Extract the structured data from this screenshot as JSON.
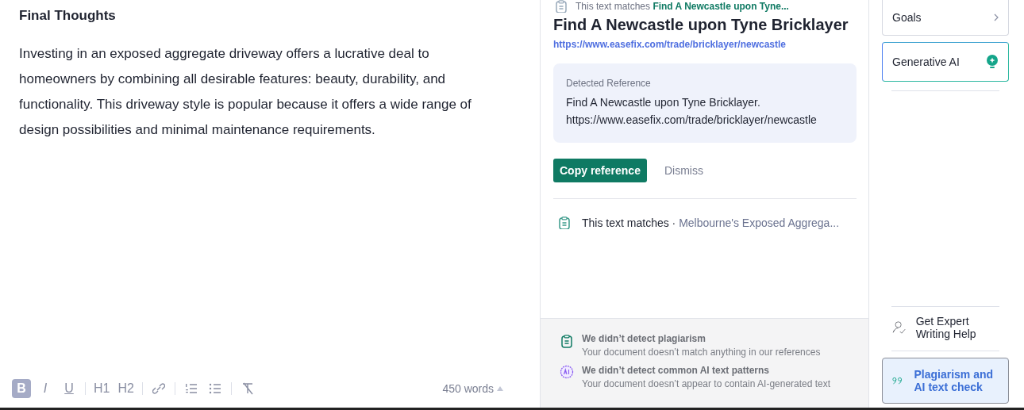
{
  "editor": {
    "heading": "Final Thoughts",
    "paragraph": "Investing in an exposed aggregate driveway offers a lucrative deal to homeowners by combining all desirable features: beauty, durability, and functionality. This driveway style is popular because it offers a wide range of design possibilities and minimal maintenance requirements.",
    "toolbar": [
      [
        {
          "kind": "bold",
          "label": "B",
          "selected": true
        },
        {
          "kind": "italic",
          "label": "I",
          "selected": false
        },
        {
          "kind": "underline",
          "label": "U",
          "selected": false
        }
      ],
      [
        {
          "kind": "heading",
          "label": "H1",
          "selected": false
        },
        {
          "kind": "heading",
          "label": "H2",
          "selected": false
        }
      ],
      [
        {
          "kind": "link",
          "selected": false
        }
      ],
      [
        {
          "kind": "numbered-list",
          "selected": false
        },
        {
          "kind": "bulleted-list",
          "selected": false
        }
      ],
      [
        {
          "kind": "clear-format",
          "selected": false
        }
      ]
    ],
    "word_count": "450 words"
  },
  "panel": {
    "top_match": {
      "prefix": "This text matches",
      "source": "Find A Newcastle upon Tyne..."
    },
    "title": "Find A Newcastle upon Tyne Bricklayer",
    "url": "https://www.easefix.com/trade/bricklayer/newcastle",
    "reference": {
      "label": "Detected Reference",
      "text": "Find A Newcastle upon Tyne Bricklayer. https://www.easefix.com/trade/bricklayer/newcastle"
    },
    "buttons": [
      {
        "kind": "primary",
        "label": "Copy reference"
      },
      {
        "kind": "plain",
        "label": "Dismiss"
      }
    ],
    "matches": [
      {
        "prefix": "This text matches ·",
        "source": "Melbourne's Exposed Aggrega..."
      }
    ],
    "checks": [
      {
        "kind": "plagiarism",
        "title": "We didn’t detect plagiarism",
        "detail": "Your document doesn’t match anything in our references"
      },
      {
        "kind": "ai",
        "title": "We didn’t detect common AI text patterns",
        "detail": "Your document doesn’t appear to contain AI-generated text"
      }
    ]
  },
  "sidebar": {
    "items": [
      {
        "kind": "nav",
        "label": "Goals"
      },
      {
        "kind": "feature",
        "label": "Generative AI"
      }
    ],
    "expert": {
      "label": "Get Expert Writing Help"
    },
    "check_button": {
      "label": "Plagiarism and AI text check",
      "selected": true
    }
  }
}
